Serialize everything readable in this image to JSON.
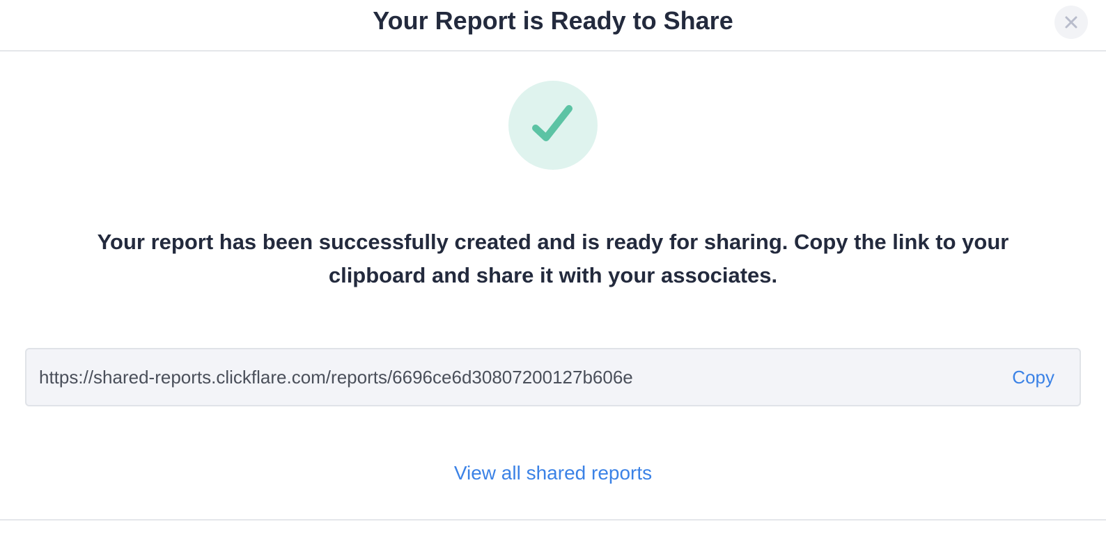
{
  "modal": {
    "title": "Your Report is Ready to Share",
    "close_icon": "close-icon",
    "success_icon": "check-icon",
    "message": "Your report has been successfully created and is ready for sharing. Copy the link to your clipboard and share it with your associates.",
    "share_link": {
      "value": "https://shared-reports.clickflare.com/reports/6696ce6d30807200127b606e",
      "copy_label": "Copy"
    },
    "view_all_label": "View all shared reports"
  },
  "colors": {
    "accent": "#3b82e6",
    "success": "#5cc3a4",
    "success_bg": "#dff3ee",
    "text": "#232a3d"
  }
}
